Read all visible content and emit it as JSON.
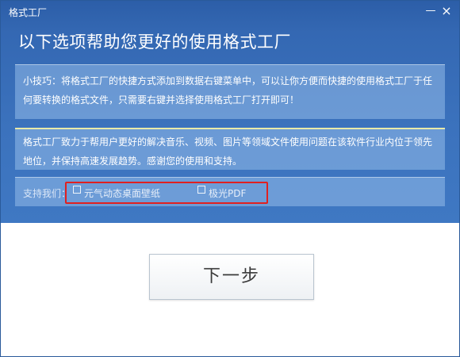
{
  "window": {
    "title": "格式工厂",
    "minimize_glyph": "—",
    "close_glyph": "×"
  },
  "main": {
    "heading": "以下选项帮助您更好的使用格式工厂",
    "tip_text": "小技巧：将格式工厂的快捷方式添加到数据右键菜单中，可以让你方便而快捷的使用格式工厂于任何要转换的格式文件，只需要右键并选择使用格式工厂打开即可！",
    "about_text": "格式工厂致力于帮用户更好的解决音乐、视频、图片等领域文件使用问题在该软件行业内位于领先地位，并保持高速发展趋势。感谢您的使用和支持。",
    "support": {
      "label": "支持我们：",
      "options": [
        {
          "label": "元气动态桌面壁纸",
          "checked": false
        },
        {
          "label": "极光PDF",
          "checked": false
        }
      ]
    },
    "next_button_label": "下一步"
  },
  "colors": {
    "title_blue": "#2c5ea8",
    "panel_blue": "#93bcea",
    "highlight_red": "#e02020",
    "divider_yellow": "#e8e9a8"
  }
}
